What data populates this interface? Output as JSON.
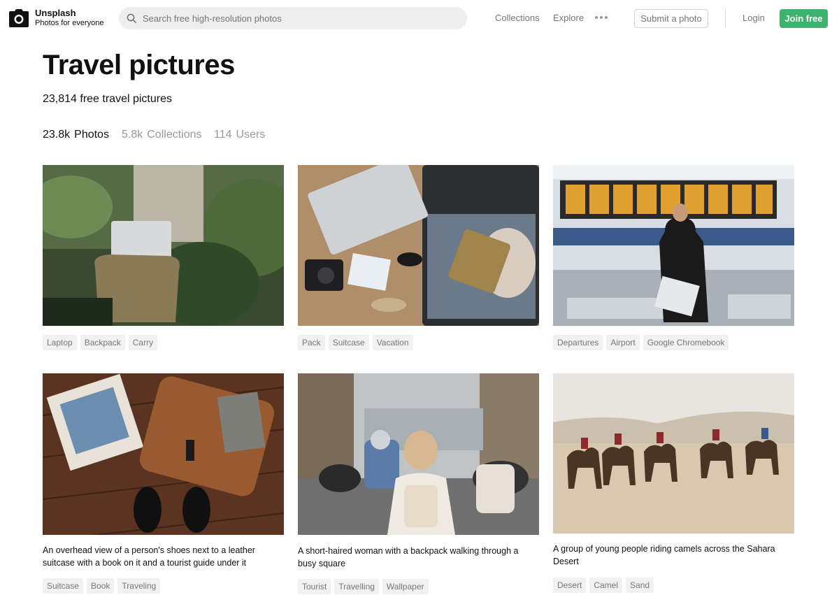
{
  "header": {
    "brand_name": "Unsplash",
    "brand_tagline": "Photos for everyone",
    "search_placeholder": "Search free high-resolution photos",
    "nav": [
      "Collections",
      "Explore"
    ],
    "submit_label": "Submit a photo",
    "login_label": "Login",
    "join_label": "Join free",
    "accent_color": "#3cb46e"
  },
  "page": {
    "title": "Travel pictures",
    "subtitle": "23,814 free travel pictures",
    "tabs": [
      {
        "count": "23.8k",
        "label": "Photos",
        "active": true
      },
      {
        "count": "5.8k",
        "label": "Collections",
        "active": false
      },
      {
        "count": "114",
        "label": "Users",
        "active": false
      }
    ]
  },
  "photos": [
    {
      "caption": "",
      "tags": [
        "Laptop",
        "Backpack",
        "Carry"
      ]
    },
    {
      "caption": "",
      "tags": [
        "Pack",
        "Suitcase",
        "Vacation"
      ]
    },
    {
      "caption": "",
      "tags": [
        "Departures",
        "Airport",
        "Google Chromebook"
      ]
    },
    {
      "caption": "An overhead view of a person's shoes next to a leather suitcase with a book on it and a tourist guide under it",
      "tags": [
        "Suitcase",
        "Book",
        "Traveling"
      ]
    },
    {
      "caption": "A short-haired woman with a backpack walking through a busy square",
      "tags": [
        "Tourist",
        "Travelling",
        "Wallpaper"
      ]
    },
    {
      "caption": "A group of young people riding camels across the Sahara Desert",
      "tags": [
        "Desert",
        "Camel",
        "Sand"
      ]
    }
  ]
}
